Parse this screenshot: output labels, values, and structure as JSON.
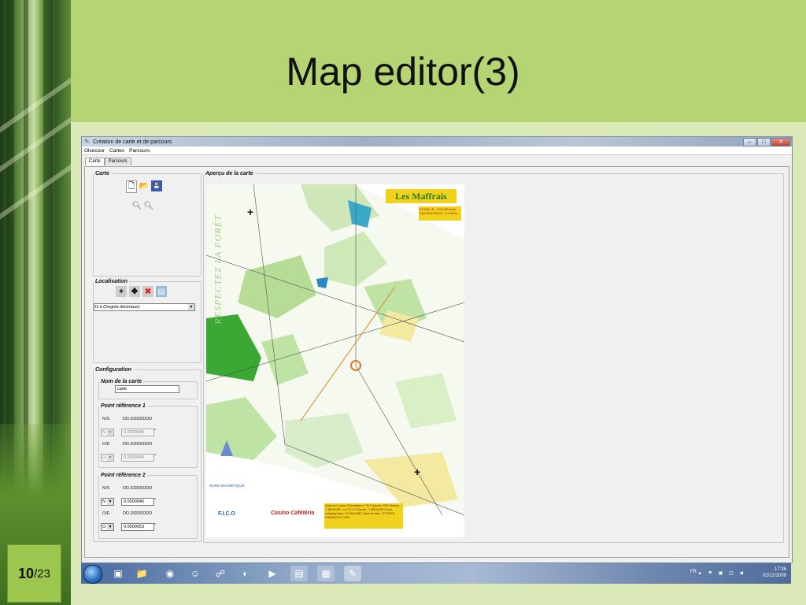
{
  "slide": {
    "title": "Map editor(3)",
    "number_current": "10",
    "number_total": "/23"
  },
  "window": {
    "title": "Création de carte et de parcours",
    "controls": {
      "minimize": "–",
      "maximize": "□",
      "close": "✕"
    },
    "menu": [
      "Olsecour",
      "Cartes",
      "Parcours"
    ],
    "tabs": [
      "Carte",
      "Parcours"
    ],
    "active_tab": "Carte"
  },
  "carte_group": {
    "legend": "Carte",
    "icons": [
      "new-file-icon",
      "open-folder-icon",
      "save-icon",
      "zoom-out-icon",
      "zoom-in-icon"
    ]
  },
  "localisation_group": {
    "legend": "Localisation",
    "icons": [
      "add-point-icon",
      "move-icon",
      "delete-icon",
      "grid-icon"
    ],
    "format_select": "D.d (Degrés décimaux)"
  },
  "configuration": {
    "legend": "Configuration",
    "nom_legend": "Nom de la carte",
    "nom_value": "carte",
    "p1": {
      "legend": "Point référence 1",
      "ns_label": "N/S",
      "ns_format": "DD.DDDDDDD",
      "ns_dir": "N",
      "ns_value": "0.0000046",
      "oe_label": "O/E",
      "oe_format": "DD.DDDDDDD",
      "oe_dir": "O",
      "oe_value": "0.0000054",
      "deg": "°"
    },
    "p2": {
      "legend": "Point référence 2",
      "ns_label": "N/S",
      "ns_format": "DD.DDDDDDD",
      "ns_dir": "N",
      "ns_value": "0.0000046",
      "oe_label": "O/E",
      "oe_format": "DD.DDDDDDD",
      "oe_dir": "O",
      "oe_value": "0.0000053",
      "deg": "°"
    }
  },
  "apercu": {
    "legend": "Aperçu de la carte",
    "map_title": "Les Maffrais",
    "map_scale": "ECHELLE : 1/10 000 ème EQUIDISTANCE : 5 mètres",
    "vertical_text": "RESPECTEZ LA FORÊT",
    "nord": "NORD MAGNÉTIQUE",
    "legend_box": "Carte de Course d'Orientation n° 35 12 janvier 2009 Relevés : Y. BEAUVIR - LA C.R.C.O Dessin : Y. BEAUVIR Coord. cartographique : D.GANVARD Carte de base : ST ROCH, DURANVILLE 1999",
    "logo1": "F.I.C.O",
    "logo2": "Casino Cafétéria"
  },
  "taskbar": {
    "lang": "FR",
    "time": "17:36",
    "date": "02/12/2009"
  },
  "colors": {
    "slide_bg": "#dbe9b8",
    "title_band": "#b5d474",
    "map_green": "#3aa832",
    "map_yellow": "#f0d21c"
  }
}
